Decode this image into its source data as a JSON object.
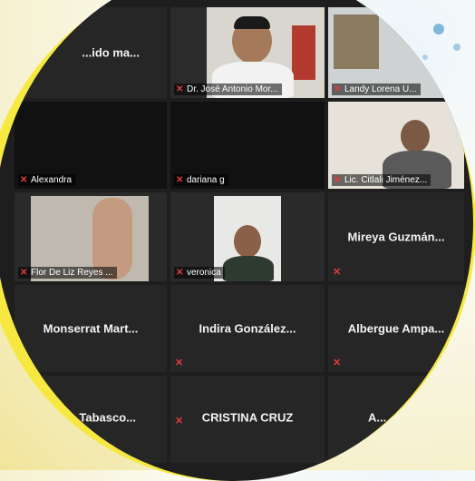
{
  "participants": {
    "p1": {
      "name": "...ido ma..."
    },
    "p2": {
      "name": "Dr. José Antonio Mor..."
    },
    "p3": {
      "name": "Landy Lorena U..."
    },
    "p4": {
      "name": "Alexandra"
    },
    "p5": {
      "name": "dariana g"
    },
    "p6": {
      "name": "Lic. Citlali Jiménez..."
    },
    "p7": {
      "name": "Flor De Liz Reyes ..."
    },
    "p8": {
      "name": "veronica"
    },
    "p9": {
      "name": "Mireya Guzmán..."
    },
    "p10": {
      "name": "Monserrat Mart..."
    },
    "p11": {
      "name": "Indira González..."
    },
    "p12": {
      "name": "Albergue Ampa..."
    },
    "p13": {
      "name": "...Tabasco..."
    },
    "p14": {
      "name": "CRISTINA CRUZ"
    },
    "p15": {
      "name": "A..."
    }
  },
  "icons": {
    "muted": "mic-muted-icon"
  },
  "colors": {
    "accent_ring": "#f6e83a",
    "tile_bg": "#262626",
    "muted_red": "#e23b3b"
  }
}
